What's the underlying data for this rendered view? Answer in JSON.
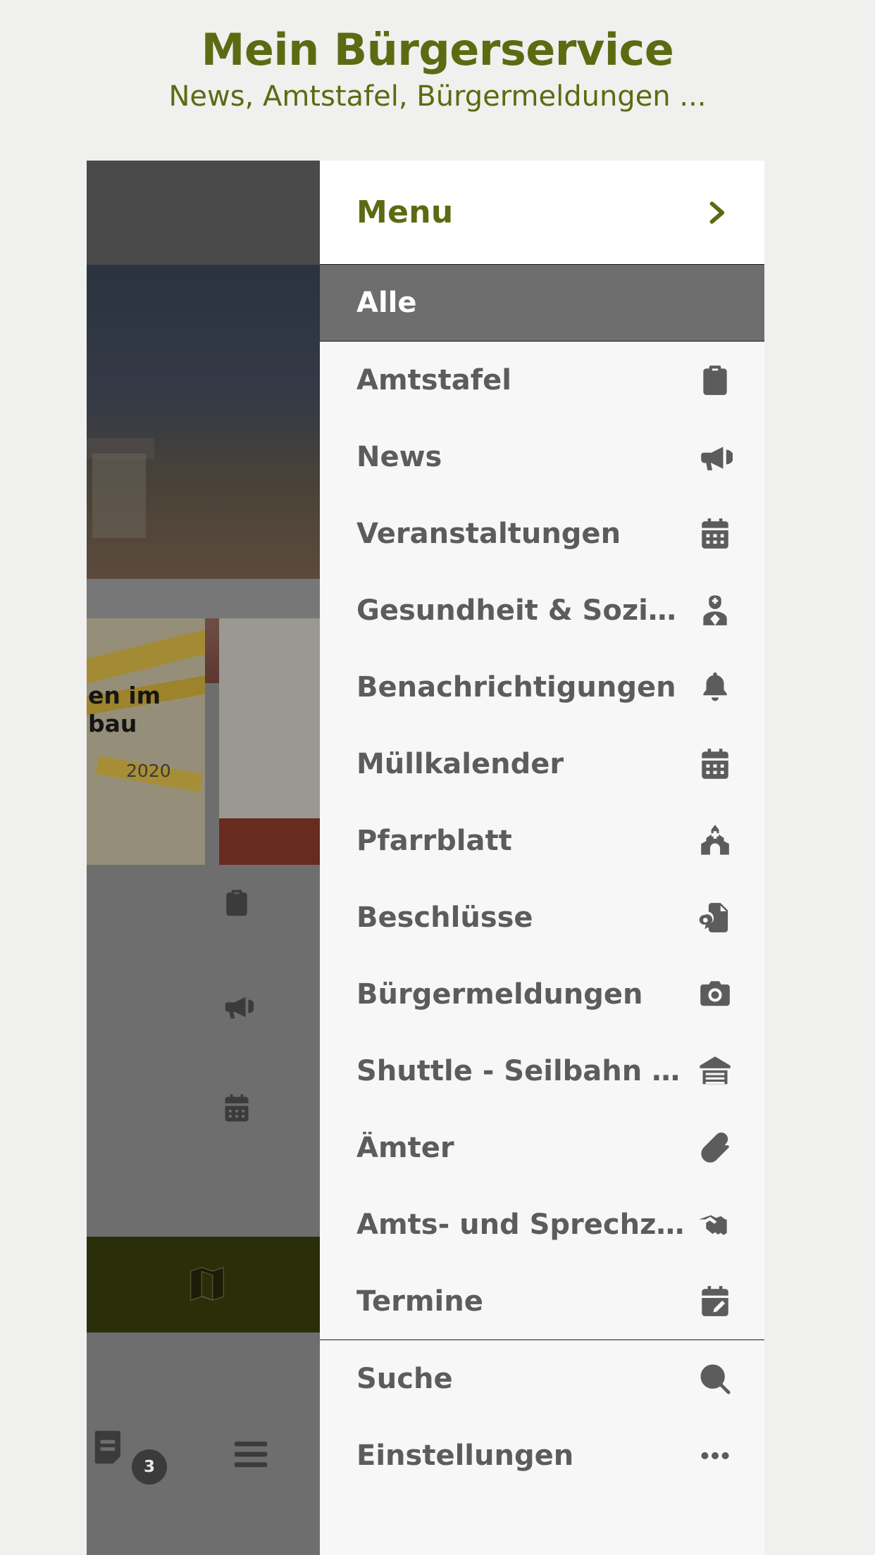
{
  "header": {
    "title": "Mein Bürgerservice",
    "subtitle": "News, Amtstafel, Bürgermeldungen ...",
    "title_color": "#5b6b12"
  },
  "drawer": {
    "title": "Menu",
    "close_icon": "chevron-right-icon",
    "active_item": {
      "label": "Alle",
      "icon": "none"
    },
    "items": [
      {
        "label": "Amtstafel",
        "icon": "clipboard-icon"
      },
      {
        "label": "News",
        "icon": "megaphone-icon"
      },
      {
        "label": "Veranstaltungen",
        "icon": "calendar-icon"
      },
      {
        "label": "Gesundheit & Soziales",
        "icon": "nurse-icon"
      },
      {
        "label": "Benachrichtigungen",
        "icon": "bell-icon"
      },
      {
        "label": "Müllkalender",
        "icon": "calendar-icon"
      },
      {
        "label": "Pfarrblatt",
        "icon": "church-icon"
      },
      {
        "label": "Beschlüsse",
        "icon": "certificate-document-icon"
      },
      {
        "label": "Bürgermeldungen",
        "icon": "camera-icon"
      },
      {
        "label": "Shuttle - Seilbahn - B...",
        "icon": "bus-station-icon"
      },
      {
        "label": "Ämter",
        "icon": "paperclip-icon"
      },
      {
        "label": "Amts- und Sprechzei...",
        "icon": "handshake-icon"
      },
      {
        "label": "Termine",
        "icon": "calendar-edit-icon"
      }
    ],
    "footer_items": [
      {
        "label": "Suche",
        "icon": "search-icon"
      },
      {
        "label": "Einstellungen",
        "icon": "ellipsis-icon"
      }
    ]
  },
  "background_app": {
    "card_title": "en im\nbau",
    "card_date": "2020",
    "badge_count": "3",
    "nav_icons": [
      "clipboard-icon",
      "megaphone-icon",
      "calendar-icon",
      "map-icon",
      "messages-icon",
      "hamburger-icon"
    ]
  },
  "colors": {
    "accent_green": "#5b6b12",
    "page_bg": "#f0f0ef",
    "drawer_bg": "#f7f7f7",
    "active_row_bg": "#6e6e6e",
    "label_gray": "#5c5c5c"
  }
}
